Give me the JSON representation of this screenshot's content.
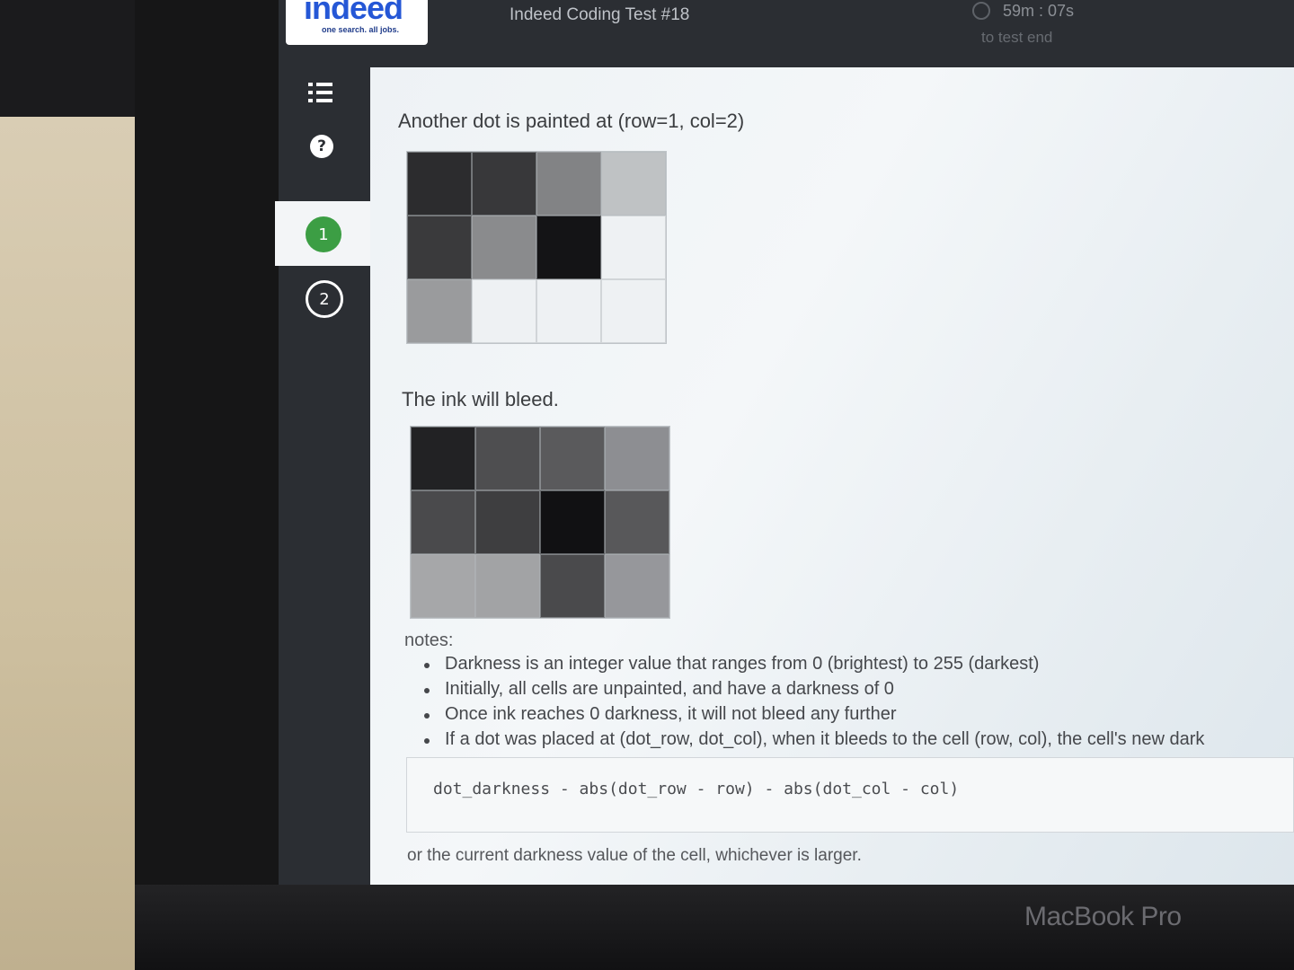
{
  "header": {
    "logo_word": "indeed",
    "logo_tagline": "one search. all jobs.",
    "test_title": "Indeed Coding Test #18",
    "timer": "59m : 07s",
    "timer_sub": "to test end"
  },
  "sidebar": {
    "items": [
      {
        "label": "",
        "icon": "list-icon"
      },
      {
        "label": "?",
        "icon": "help-icon"
      },
      {
        "label": "1",
        "icon": "question-number",
        "active": true,
        "color": "#3c9e44"
      },
      {
        "label": "2",
        "icon": "question-number",
        "active": false
      }
    ]
  },
  "content": {
    "caption1": "Another dot is painted at (row=1, col=2)",
    "grid1": [
      [
        "#2c2c2e",
        "#38383a",
        "#828385",
        "#bfc2c4"
      ],
      [
        "#3a3a3c",
        "#8a8b8d",
        "#141416",
        "#eef1f3"
      ],
      [
        "#9a9b9d",
        "#eef1f3",
        "#eef1f3",
        "#eef1f3"
      ]
    ],
    "caption2": "The ink will bleed.",
    "grid2": [
      [
        "#222224",
        "#4e4e50",
        "#5a5a5c",
        "#8d8e92"
      ],
      [
        "#4a4a4c",
        "#3e3e40",
        "#111113",
        "#58585a"
      ],
      [
        "#a6a7a9",
        "#a2a3a5",
        "#4a4a4c",
        "#96979b"
      ]
    ],
    "notes_title": "notes:",
    "notes": [
      "Darkness is an integer value that ranges from 0 (brightest) to 255 (darkest)",
      "Initially, all cells are unpainted, and have a darkness of 0",
      "Once ink reaches 0 darkness, it will not bleed any further",
      "If a dot was placed at (dot_row, dot_col), when it bleeds to the cell (row, col), the cell's new dark"
    ],
    "code": "dot_darkness - abs(dot_row - row) - abs(dot_col - col)",
    "closing": "or the current darkness value of the cell, whichever is larger."
  },
  "device_label": "MacBook Pro"
}
